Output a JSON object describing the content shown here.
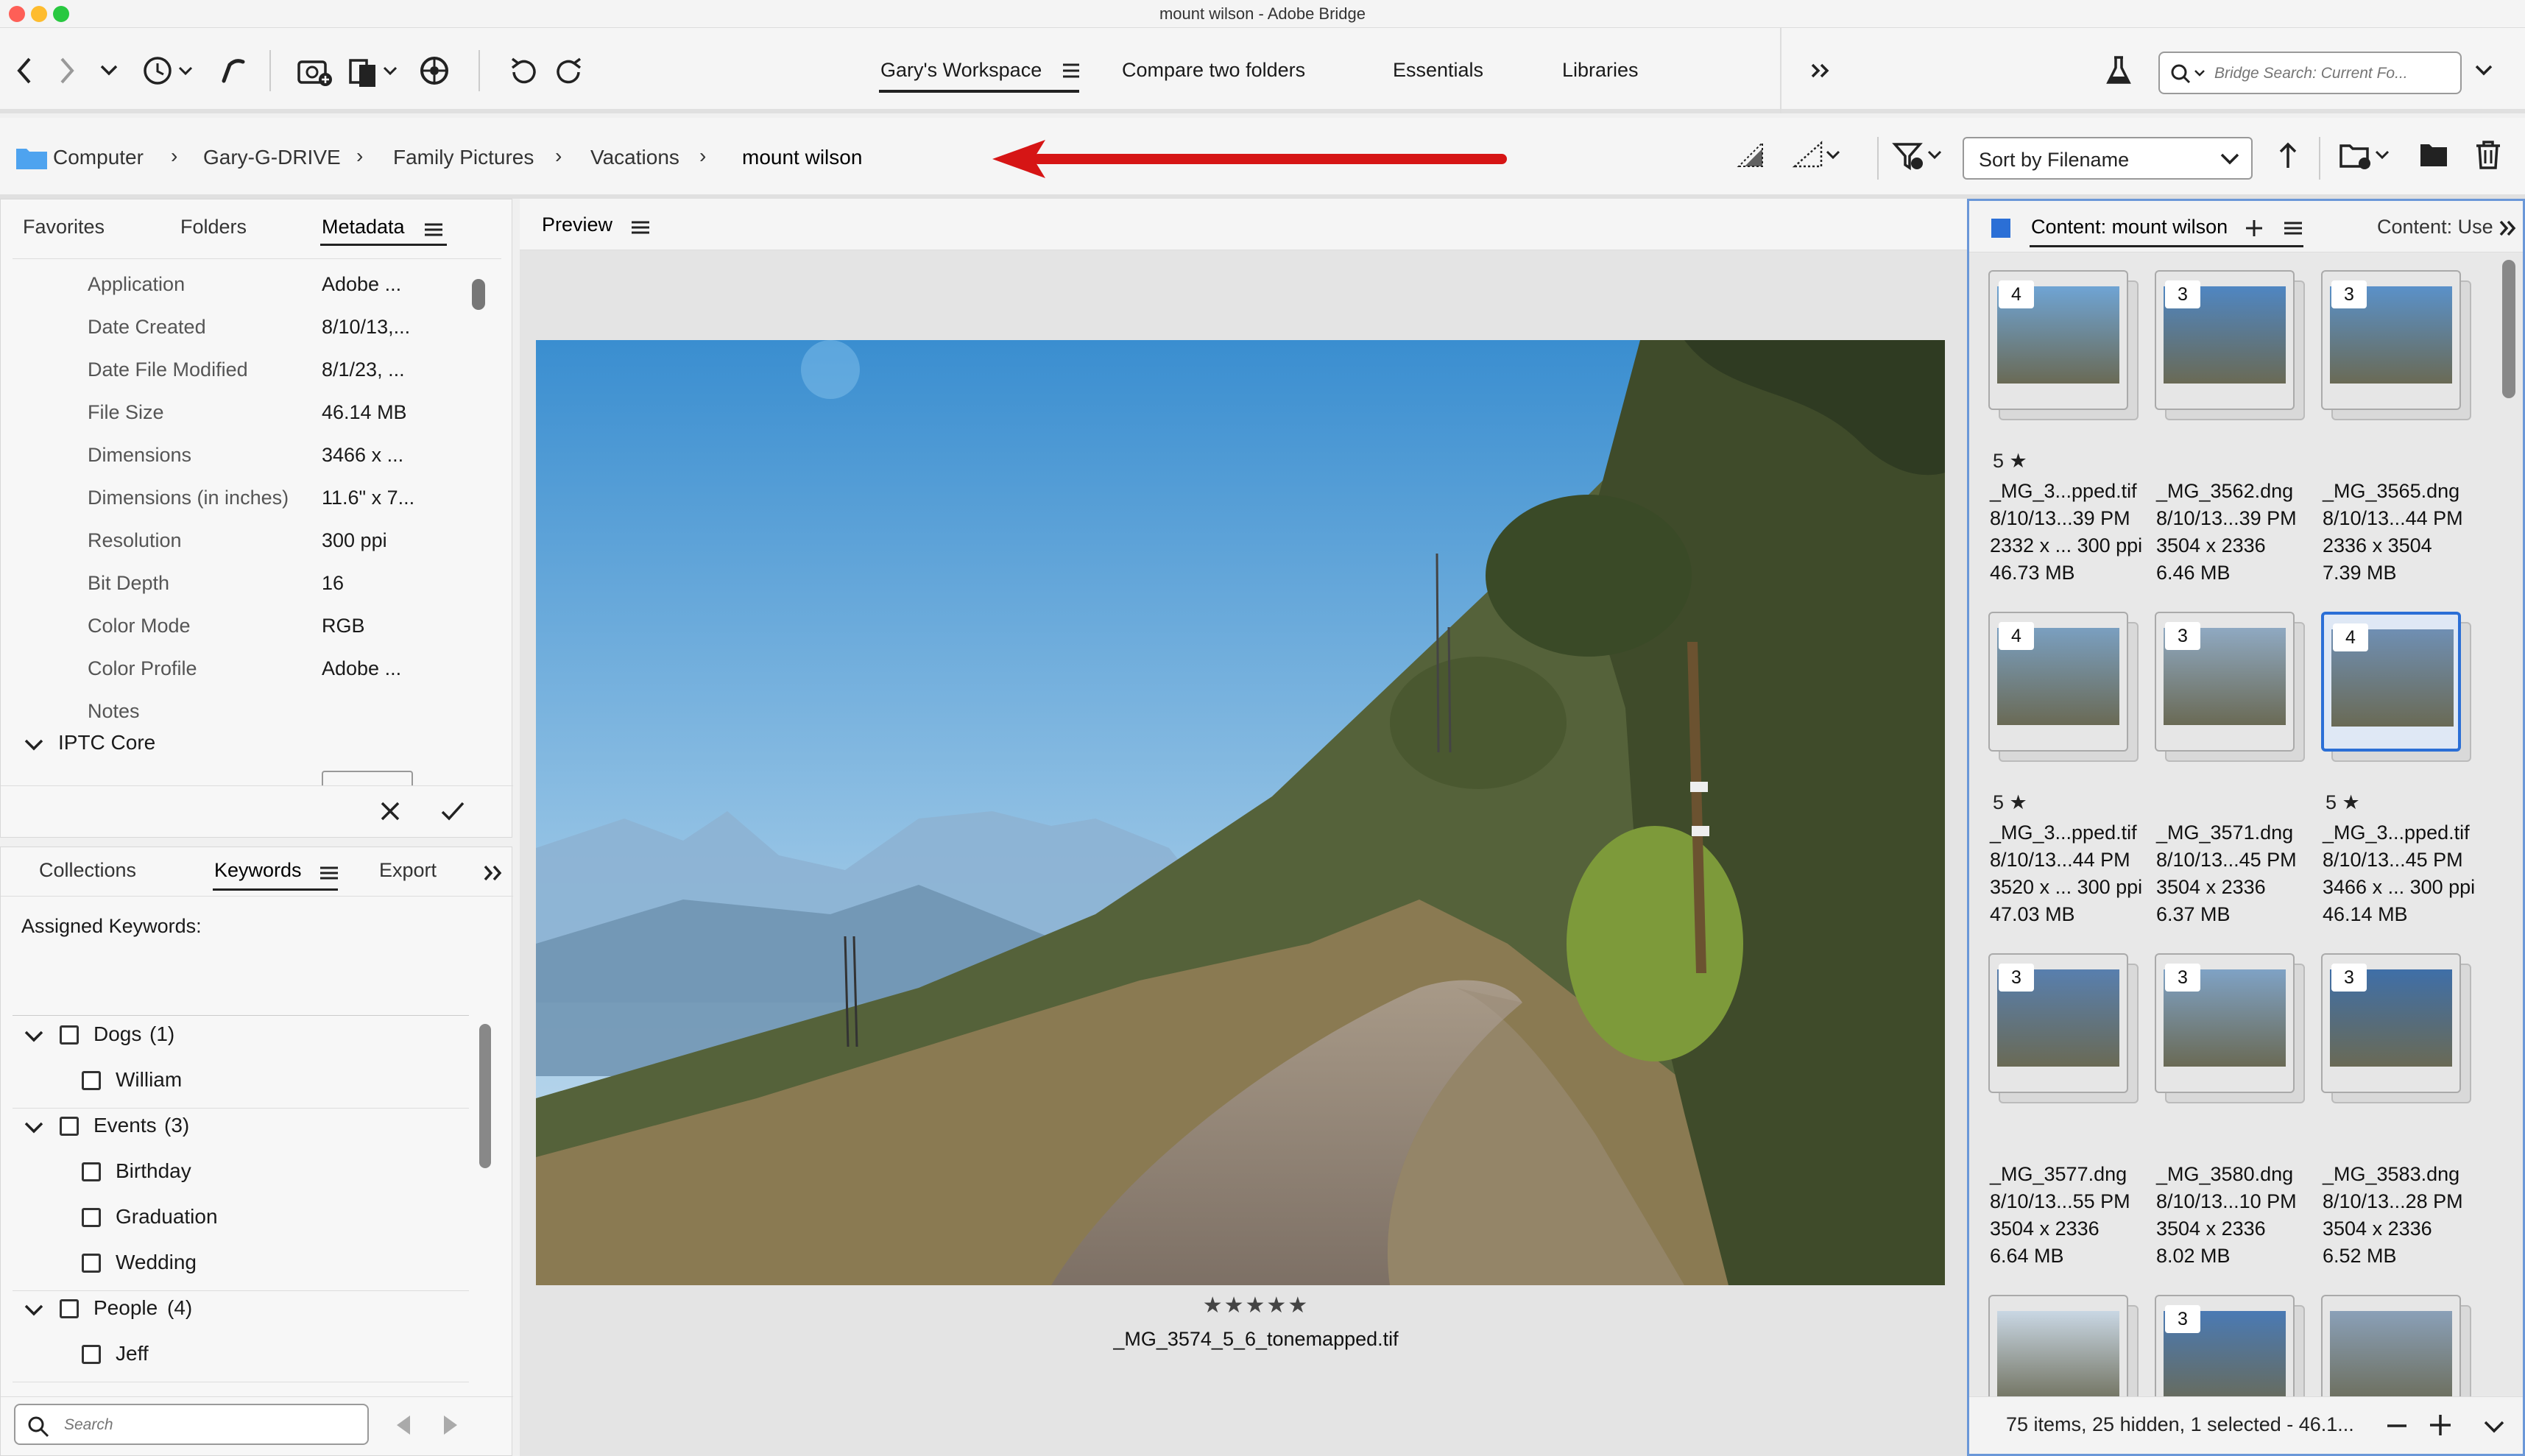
{
  "window": {
    "title": "mount wilson - Adobe Bridge"
  },
  "colors": {
    "accent": "#2b6fd6",
    "arrow": "#d61515",
    "folder": "#4ea3ef"
  },
  "workspaces": [
    {
      "label": "Gary's Workspace",
      "active": true
    },
    {
      "label": "Compare two folders"
    },
    {
      "label": "Essentials"
    },
    {
      "label": "Libraries"
    }
  ],
  "search": {
    "placeholder": "Bridge Search: Current Fo..."
  },
  "path": {
    "crumbs": [
      "Computer",
      "Gary-G-DRIVE",
      "Family Pictures",
      "Vacations",
      "mount wilson"
    ]
  },
  "sort": {
    "label": "Sort by Filename"
  },
  "meta_panel": {
    "tabs": [
      "Favorites",
      "Folders",
      "Metadata"
    ],
    "rows": [
      {
        "label": "Application",
        "value": "Adobe ..."
      },
      {
        "label": "Date Created",
        "value": "8/10/13,..."
      },
      {
        "label": "Date File Modified",
        "value": "8/1/23, ..."
      },
      {
        "label": "File Size",
        "value": "46.14 MB"
      },
      {
        "label": "Dimensions",
        "value": "3466 x ..."
      },
      {
        "label": "Dimensions (in inches)",
        "value": "11.6\" x 7..."
      },
      {
        "label": "Resolution",
        "value": "300 ppi"
      },
      {
        "label": "Bit Depth",
        "value": "16"
      },
      {
        "label": "Color Mode",
        "value": "RGB"
      },
      {
        "label": "Color Profile",
        "value": "Adobe ..."
      },
      {
        "label": "Notes",
        "value": ""
      }
    ],
    "section": "IPTC Core"
  },
  "kw_panel": {
    "tabs": [
      "Collections",
      "Keywords",
      "Export"
    ],
    "assigned_label": "Assigned Keywords:",
    "groups": [
      {
        "name": "Dogs",
        "count": "(1)",
        "children": [
          "William"
        ]
      },
      {
        "name": "Events",
        "count": "(3)",
        "children": [
          "Birthday",
          "Graduation",
          "Wedding"
        ]
      },
      {
        "name": "People",
        "count": "(4)",
        "children": [
          "Jeff"
        ]
      }
    ],
    "search_placeholder": "Search"
  },
  "preview": {
    "tab": "Preview",
    "rating": "★★★★★",
    "filename": "_MG_3574_5_6_tonemapped.tif"
  },
  "content": {
    "tab": "Content: mount wilson",
    "tab2": "Content: Use",
    "items": [
      {
        "badge": "4",
        "stars": "5 ★",
        "name": "_MG_3...pped.tif",
        "date": "8/10/13...39 PM",
        "dims": "2332 x ... 300 ppi",
        "size": "46.73 MB"
      },
      {
        "badge": "3",
        "stars": "",
        "name": "_MG_3562.dng",
        "date": "8/10/13...39 PM",
        "dims": "3504 x 2336",
        "size": "6.46 MB"
      },
      {
        "badge": "3",
        "stars": "",
        "name": "_MG_3565.dng",
        "date": "8/10/13...44 PM",
        "dims": "2336 x 3504",
        "size": "7.39 MB"
      },
      {
        "badge": "4",
        "stars": "5 ★",
        "name": "_MG_3...pped.tif",
        "date": "8/10/13...44 PM",
        "dims": "3520 x ... 300 ppi",
        "size": "47.03 MB"
      },
      {
        "badge": "3",
        "stars": "",
        "name": "_MG_3571.dng",
        "date": "8/10/13...45 PM",
        "dims": "3504 x 2336",
        "size": "6.37 MB"
      },
      {
        "badge": "4",
        "stars": "5 ★",
        "name": "_MG_3...pped.tif",
        "date": "8/10/13...45 PM",
        "dims": "3466 x ... 300 ppi",
        "size": "46.14 MB",
        "selected": true
      },
      {
        "badge": "3",
        "stars": "",
        "name": "_MG_3577.dng",
        "date": "8/10/13...55 PM",
        "dims": "3504 x 2336",
        "size": "6.64 MB"
      },
      {
        "badge": "3",
        "stars": "",
        "name": "_MG_3580.dng",
        "date": "8/10/13...10 PM",
        "dims": "3504 x 2336",
        "size": "8.02 MB"
      },
      {
        "badge": "3",
        "stars": "",
        "name": "_MG_3583.dng",
        "date": "8/10/13...28 PM",
        "dims": "3504 x 2336",
        "size": "6.52 MB"
      },
      {
        "badge": "",
        "name": ""
      },
      {
        "badge": "3",
        "name": ""
      },
      {
        "badge": "",
        "name": ""
      }
    ],
    "status": "75 items, 25 hidden, 1 selected - 46.1..."
  }
}
